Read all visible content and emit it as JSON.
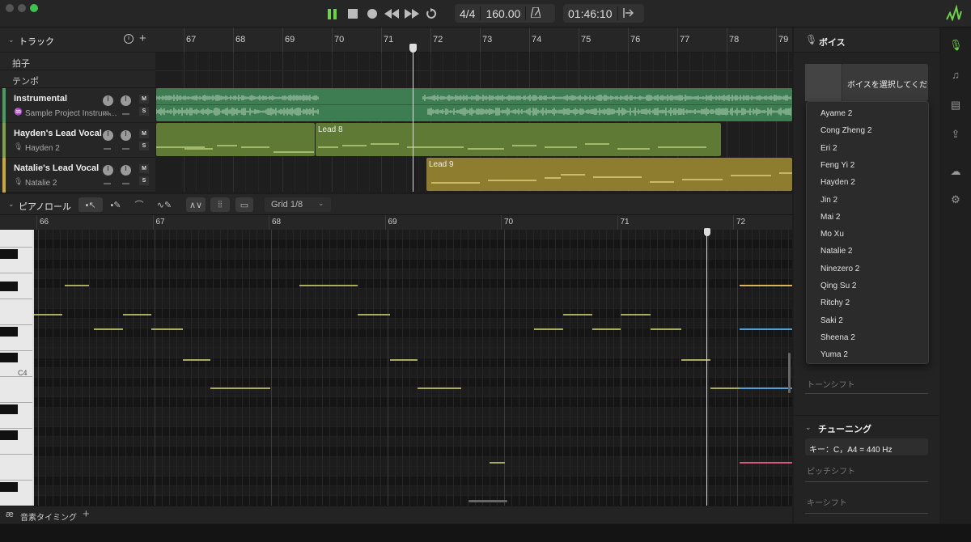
{
  "transport": {
    "time_signature": "4/4",
    "tempo": "160.00",
    "time": "01:46:10"
  },
  "tracks_panel": {
    "title": "トラック",
    "ruler": [
      "67",
      "68",
      "69",
      "70",
      "71",
      "72",
      "73",
      "74",
      "75",
      "76",
      "77",
      "78",
      "79"
    ],
    "meter_label": "拍子",
    "tempo_label": "テンポ",
    "tracks": [
      {
        "name": "Instrumental",
        "sub": "Sample Project Instrum…",
        "color": "#4a9a62"
      },
      {
        "name": "Hayden's Lead Vocal",
        "sub": "Hayden 2",
        "color": "#7ea04a"
      },
      {
        "name": "Natalie's Lead Vocal",
        "sub": "Natalie 2",
        "color": "#c8a83e"
      }
    ],
    "mute": "M",
    "solo": "S",
    "clips": [
      {
        "label": "Lead 8"
      },
      {
        "label": "Lead 9"
      }
    ]
  },
  "piano_roll": {
    "title": "ピアノロール",
    "grid": "Grid 1/8",
    "ruler": [
      "66",
      "67",
      "68",
      "69",
      "70",
      "71",
      "72"
    ],
    "c4": "C4",
    "footer": "音素タイミング"
  },
  "voice_panel": {
    "title": "ボイス",
    "select_button": "ボイスを選択してくだ",
    "voices": [
      "Ayame 2",
      "Cong Zheng 2",
      "Eri 2",
      "Feng Yi 2",
      "Hayden 2",
      "Jin 2",
      "Mai 2",
      "Mo Xu",
      "Natalie 2",
      "Ninezero 2",
      "Qing Su 2",
      "Ritchy 2",
      "Saki 2",
      "Sheena 2",
      "Yuma 2"
    ],
    "tone_shift": "トーンシフト",
    "tuning_title": "チューニング",
    "key_value": "キー：C，A4 = 440 Hz",
    "pitch_shift": "ピッチシフト",
    "key_shift": "キーシフト"
  },
  "sidebar_icons": [
    "mic-icon",
    "music-note-icon",
    "document-icon",
    "export-icon",
    "cloud-icon",
    "gear-icon"
  ]
}
